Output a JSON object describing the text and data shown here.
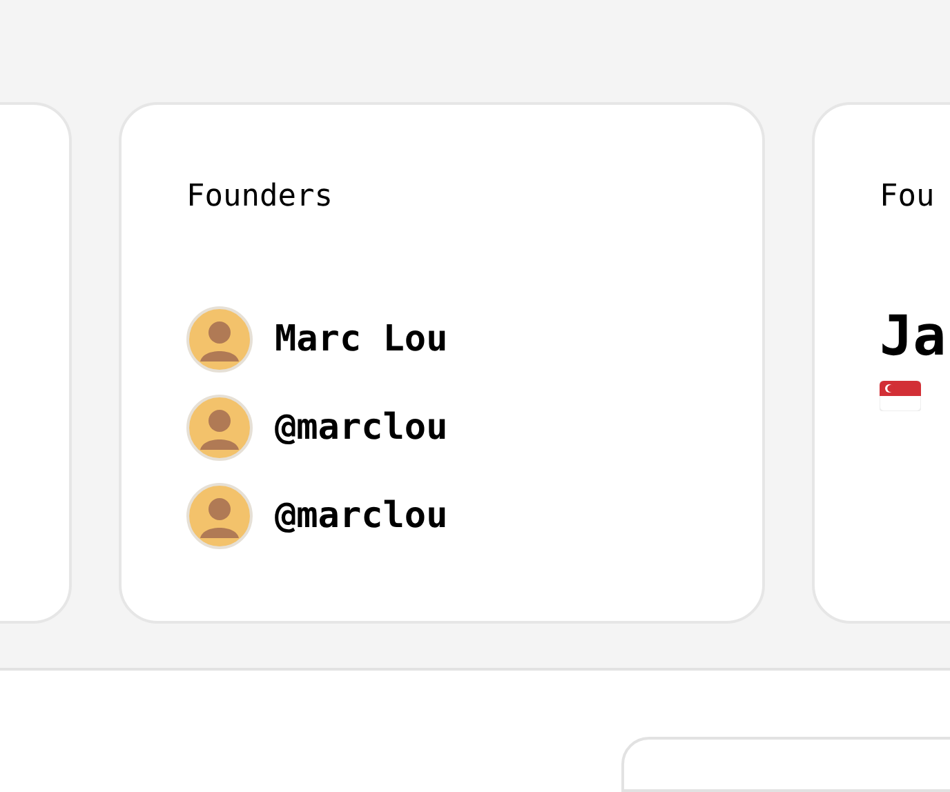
{
  "cards": [
    {
      "kind": "empty"
    },
    {
      "kind": "founders",
      "title": "Founders",
      "founders": [
        {
          "name": "Marc Lou"
        },
        {
          "name": "@marclou"
        },
        {
          "name": "@marclou"
        }
      ]
    },
    {
      "kind": "profile",
      "title": "Fou",
      "name": "Ja"
    }
  ]
}
